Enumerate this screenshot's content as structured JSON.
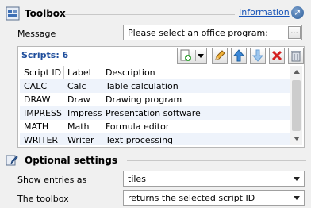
{
  "header": {
    "title": "Toolbox",
    "info_link": "Information",
    "collapse_icon": "collapse-icon"
  },
  "message": {
    "label": "Message",
    "value": "Please select an office program:",
    "button_label": "..."
  },
  "scripts": {
    "count_label": "Scripts: 6",
    "toolbar_icons": [
      "add-icon",
      "dropdown-arrow-icon",
      "edit-pencil-icon",
      "move-up-icon",
      "move-down-icon",
      "delete-icon",
      "clear-icon"
    ],
    "columns": [
      "Script ID",
      "Label",
      "Description"
    ],
    "rows": [
      [
        "CALC",
        "Calc",
        "Table calculation"
      ],
      [
        "DRAW",
        "Draw",
        "Drawing program"
      ],
      [
        "IMPRESS",
        "Impress",
        "Presentation software"
      ],
      [
        "MATH",
        "Math",
        "Formula editor"
      ],
      [
        "WRITER",
        "Writer",
        "Text processing"
      ]
    ]
  },
  "optional": {
    "title": "Optional settings",
    "show_entries_label": "Show entries as",
    "show_entries_value": "tiles",
    "toolbox_label": "The toolbox",
    "toolbox_value": "returns the selected script ID"
  },
  "colors": {
    "accent": "#1f4e9c",
    "link": "#1a55b8",
    "alt_row": "#eef3fb"
  }
}
